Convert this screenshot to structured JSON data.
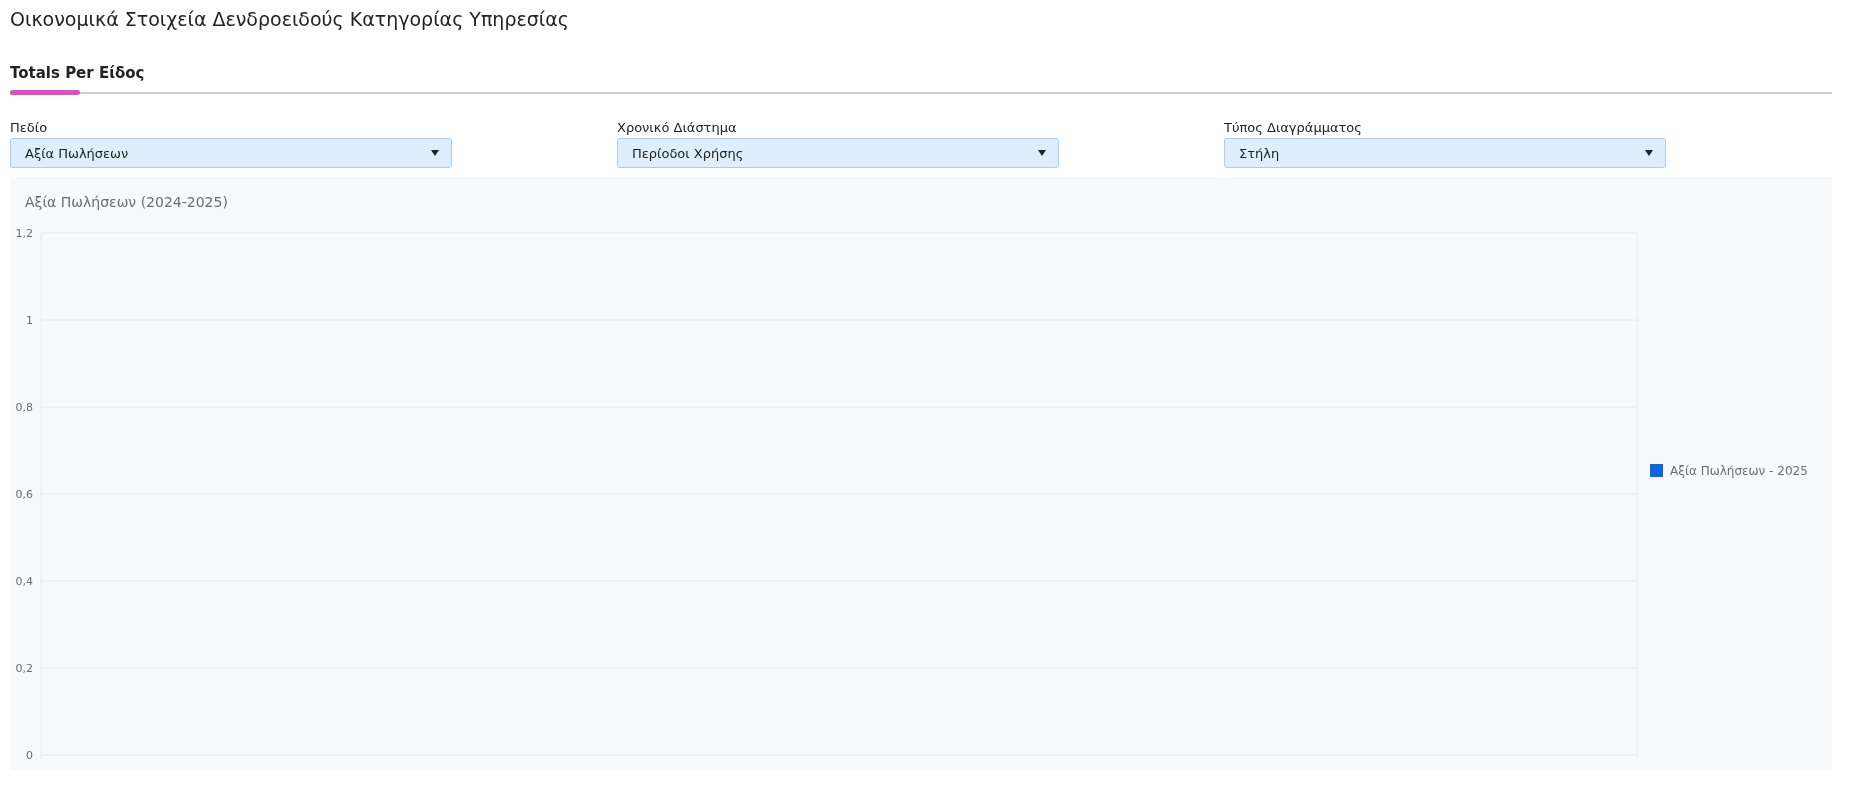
{
  "page_title": "Οικονομικά Στοιχεία Δενδροειδούς Κατηγορίας Υπηρεσίας",
  "tabs": [
    {
      "label": "Totals Per Είδος",
      "selected": true
    }
  ],
  "filters": [
    {
      "label": "Πεδίο",
      "value": "Αξία Πωλήσεων"
    },
    {
      "label": "Χρονικό Διάστημα",
      "value": "Περίοδοι Χρήσης"
    },
    {
      "label": "Τύπος Διαγράμματος",
      "value": "Στήλη"
    }
  ],
  "chart": {
    "chart_data": {
      "type": "bar",
      "title": "Αξία Πωλήσεων (2024-2025)",
      "ylim": [
        0,
        1.2
      ],
      "grid": true,
      "yticks": [
        {
          "value": 0,
          "label": "0"
        },
        {
          "value": 0.2,
          "label": "0,2"
        },
        {
          "value": 0.4,
          "label": "0,4"
        },
        {
          "value": 0.6,
          "label": "0,6"
        },
        {
          "value": 0.8,
          "label": "0,8"
        },
        {
          "value": 1,
          "label": "1"
        },
        {
          "value": 1.2,
          "label": "1,2"
        }
      ],
      "series": [
        {
          "name": "Αξία Πωλήσεων - 2025",
          "color": "#0b67e0"
        }
      ]
    }
  }
}
